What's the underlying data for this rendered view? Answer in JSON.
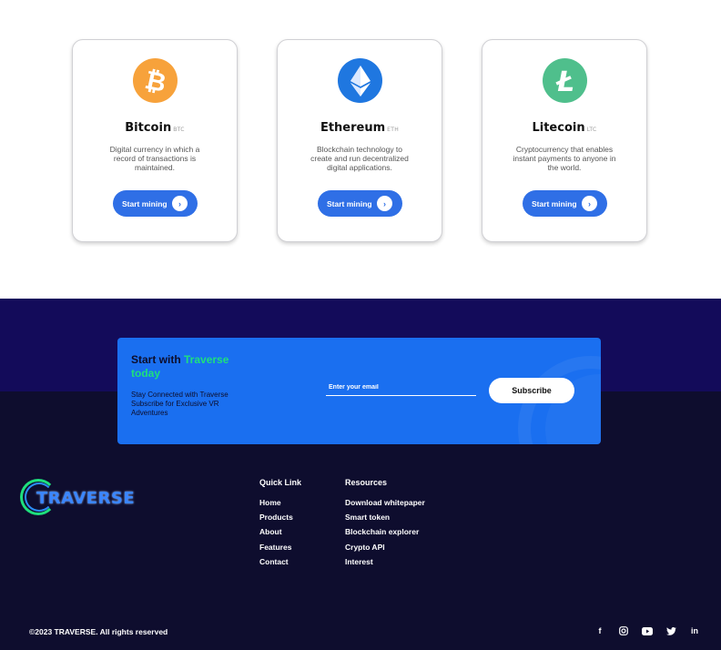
{
  "cards": [
    {
      "name": "Bitcoin",
      "symbol": "BTC",
      "description": "Digital currency in which a record of transactions is maintained.",
      "button": "Start mining",
      "icon": "bitcoin-icon",
      "glyph": "₿",
      "color": "#f7a23b"
    },
    {
      "name": "Ethereum",
      "symbol": "ETH",
      "description": "Blockchain technology to create and run decentralized digital applications.",
      "button": "Start mining",
      "icon": "ethereum-icon",
      "glyph": "◆",
      "color": "#1f77e0"
    },
    {
      "name": "Litecoin",
      "symbol": "LTC",
      "description": "Cryptocurrency that enables instant payments to anyone in the world.",
      "button": "Start mining",
      "icon": "litecoin-icon",
      "glyph": "Ł",
      "color": "#4fbf8c"
    }
  ],
  "newsletter": {
    "title_prefix": "Start with ",
    "title_accent": "Traverse today",
    "subtitle": "Stay Connected with Traverse Subscribe for Exclusive VR Adventures",
    "email_placeholder": "Enter your email",
    "subscribe_label": "Subscribe"
  },
  "footer": {
    "logo_text": "TRAVERSE",
    "quick_link": {
      "heading": "Quick Link",
      "links": [
        "Home",
        "Products",
        "About",
        "Features",
        "Contact"
      ]
    },
    "resources": {
      "heading": "Resources",
      "links": [
        "Download whitepaper",
        "Smart token",
        "Blockchain explorer",
        "Crypto API",
        "Interest"
      ]
    },
    "copyright": "©2023 TRAVERSE. All rights reserved",
    "socials": [
      {
        "icon": "facebook-icon",
        "glyph": "f"
      },
      {
        "icon": "instagram-icon",
        "glyph": "◎"
      },
      {
        "icon": "youtube-icon",
        "glyph": "▶"
      },
      {
        "icon": "twitter-icon",
        "glyph": "🐦"
      },
      {
        "icon": "linkedin-icon",
        "glyph": "in"
      }
    ]
  },
  "colors": {
    "primary_blue": "#1a6ff0",
    "accent_green": "#1ee07d",
    "footer_bg": "#0e0d2e",
    "footer_band": "#130b5a"
  }
}
